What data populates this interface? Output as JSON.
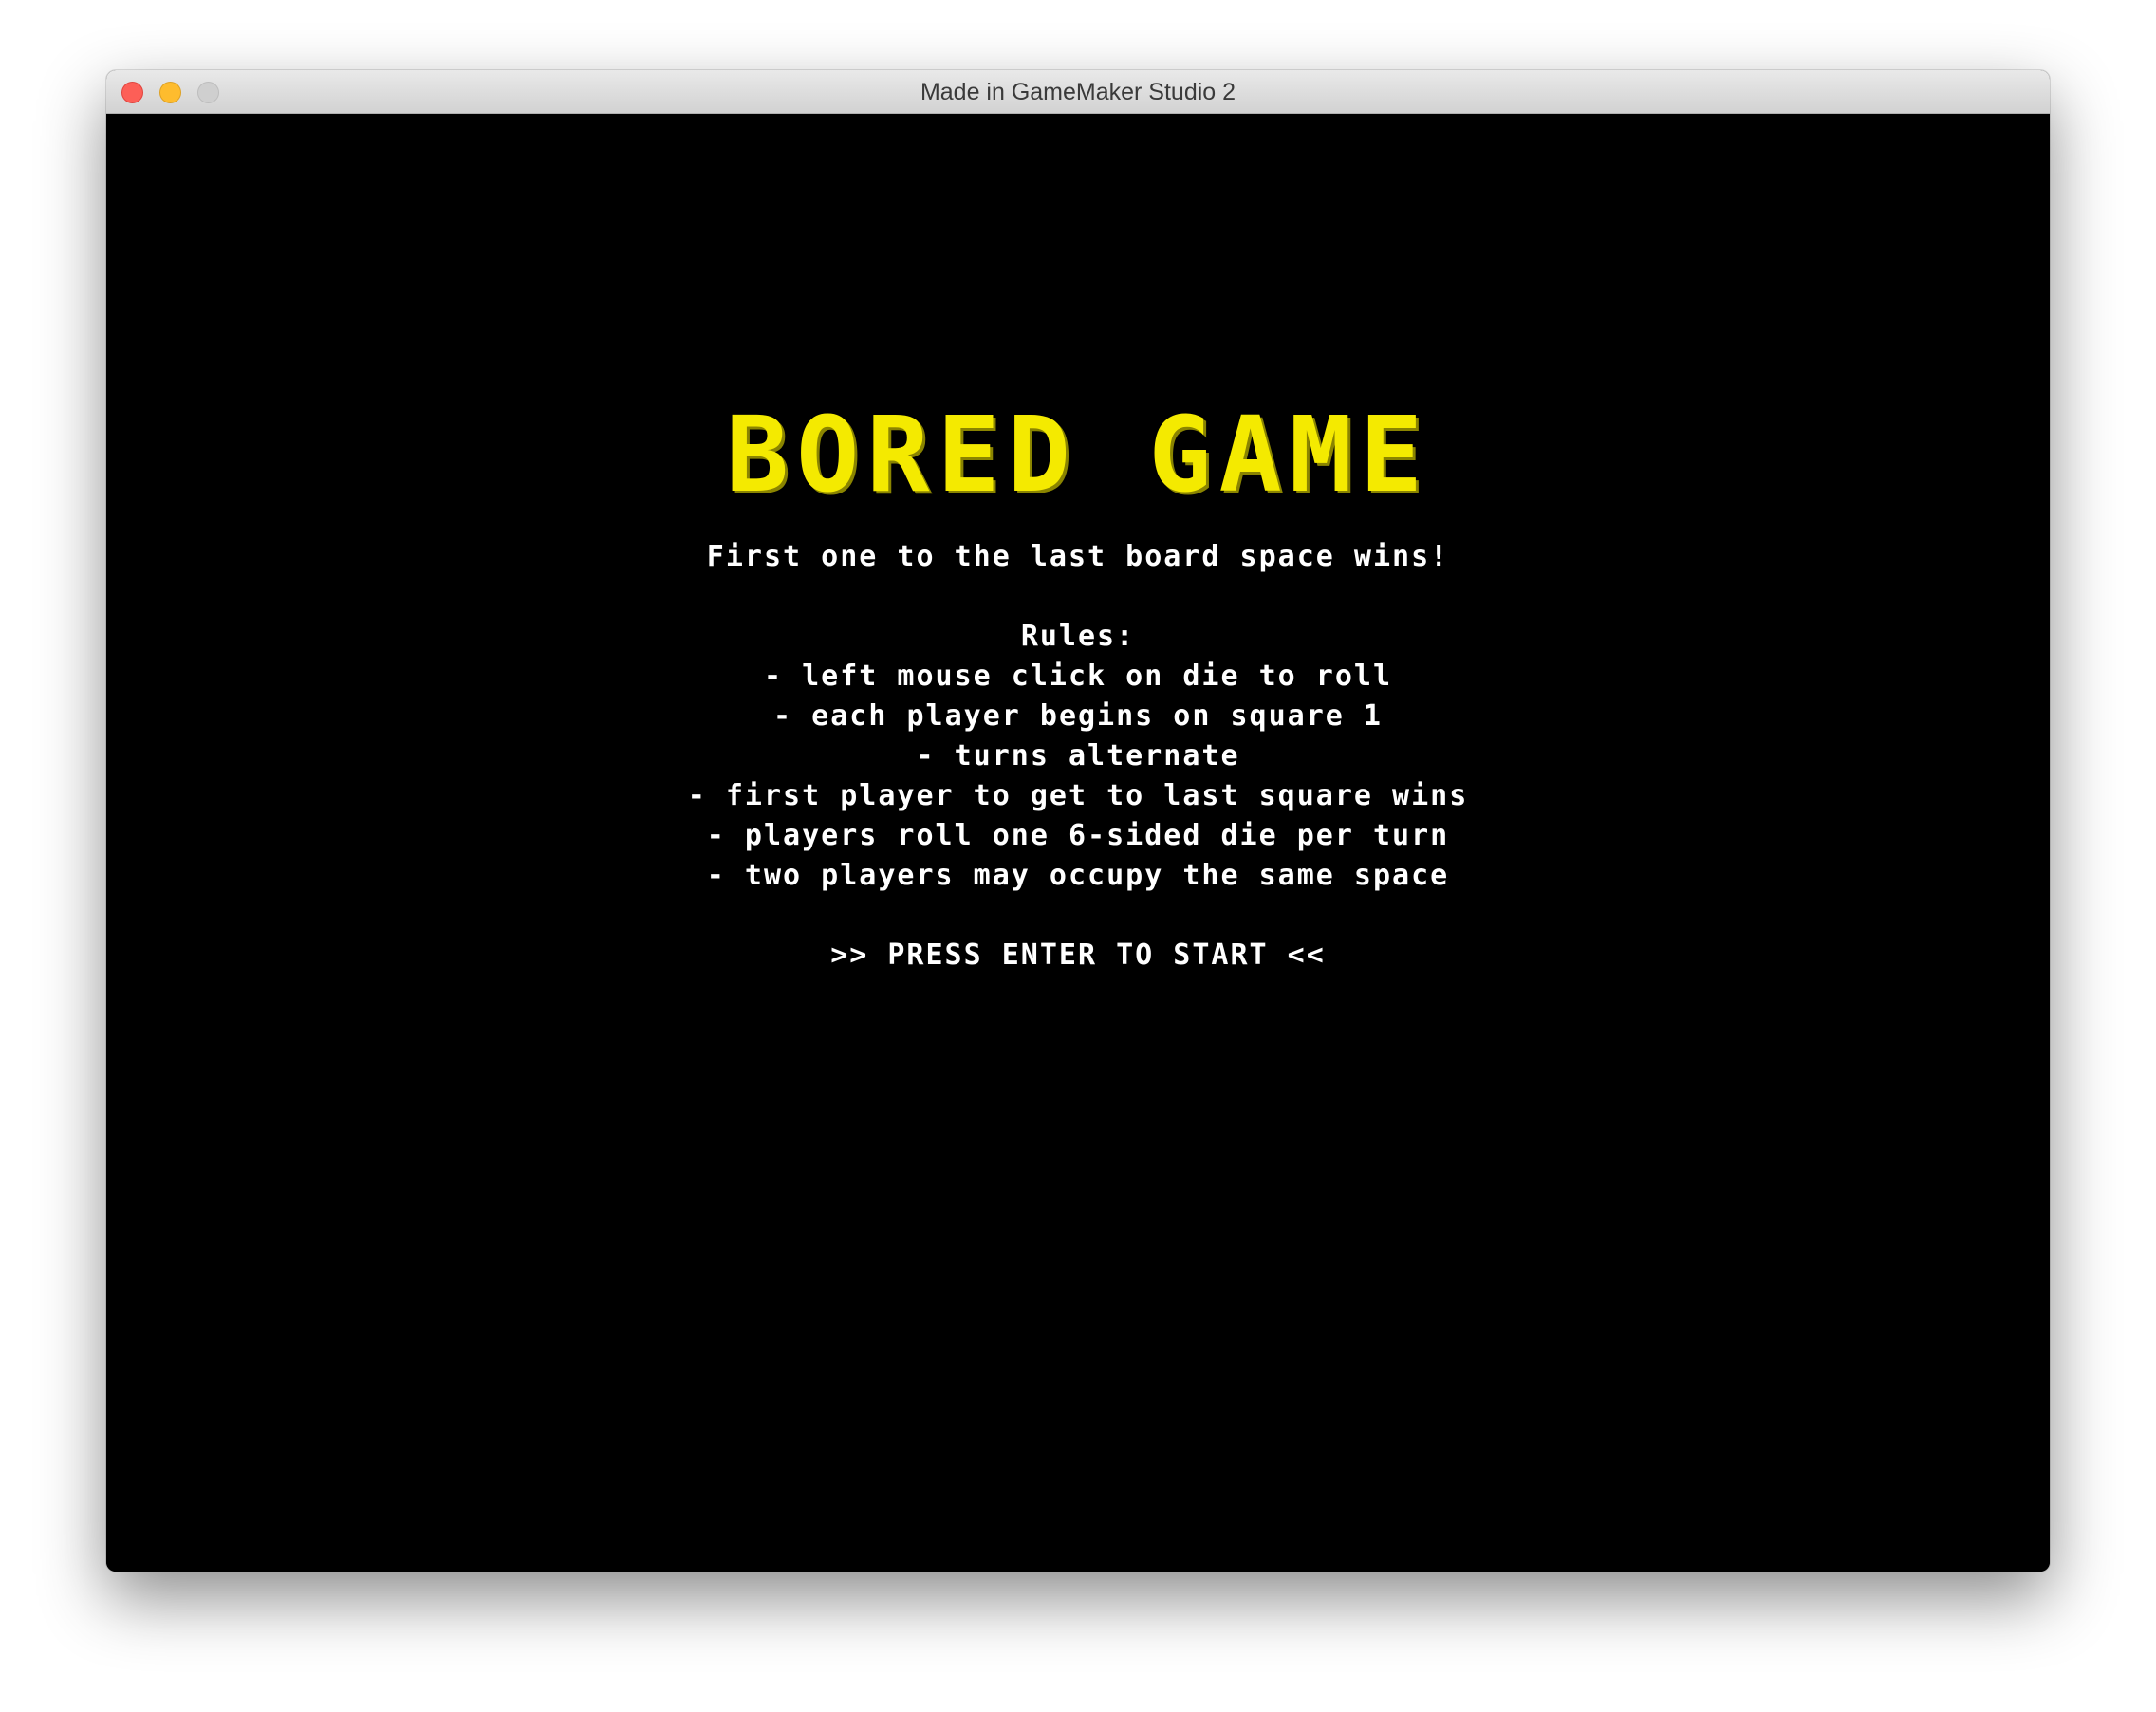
{
  "window": {
    "title": "Made in GameMaker Studio 2"
  },
  "game": {
    "title": "BORED GAME",
    "tagline": "First one to the last board space wins!",
    "rules_heading": "Rules:",
    "rules": [
      "- left mouse click on die to roll",
      "- each player begins on square 1",
      "- turns alternate",
      "- first player to get to last square wins",
      "- players roll one 6-sided die per turn",
      "- two players may occupy the same space"
    ],
    "start_prompt": ">> PRESS ENTER TO START <<"
  },
  "colors": {
    "title_yellow": "#f4ea00",
    "text_white": "#ffffff",
    "background": "#000000"
  }
}
